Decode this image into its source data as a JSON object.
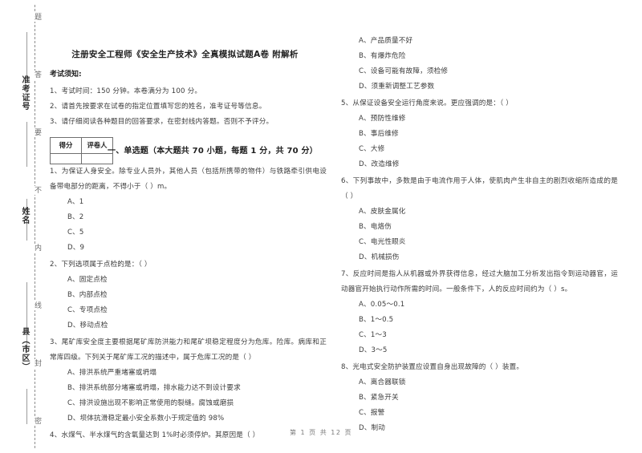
{
  "document": {
    "title": "注册安全工程师《安全生产技术》全真模拟试题A卷 附解析",
    "footer": "第 1 页 共 12 页"
  },
  "margin": {
    "labels": [
      "准考证号",
      "姓名",
      "县（市区）"
    ],
    "seal_chars": [
      "题",
      "答",
      "要",
      "不",
      "内",
      "线",
      "封",
      "密"
    ]
  },
  "notice": {
    "heading": "考试须知:",
    "items": [
      "1、考试时间：150 分钟。本卷满分为 100 分。",
      "2、请首先按要求在试卷的指定位置填写您的姓名，准考证号等信息。",
      "3、请仔细阅读各种题目的回答要求，在密封线内答题。否则不予评分。"
    ]
  },
  "score_box": {
    "col1": "得分",
    "col2": "评卷人",
    "value1": "",
    "value2": ""
  },
  "section": {
    "heading": "一、单选题（本大题共 70 小题，每题 1 分，共 70 分）"
  },
  "questions": {
    "q1": {
      "stem": "1、为保证人身安全。除专业人员外，其他人员（包括所携带的物件）与铁路牵引供电设备带电部分的距离，不得小于（     ）m。",
      "options": [
        "A、1",
        "B、2",
        "C、5",
        "D、9"
      ]
    },
    "q2": {
      "stem": "2、下列选项属于点检的是：（     ）",
      "options": [
        "A、固定点检",
        "B、内部点检",
        "C、专项点检",
        "D、移动点检"
      ]
    },
    "q3": {
      "stem": "3、尾矿库安全度主要根据尾矿库防洪能力和尾矿坝稳定程度分为危库。险库。病库和正常库四级。下列关于尾矿库工况的描述中，属于危库工况的是（     ）",
      "options": [
        "A、排洪系统严重堵塞或坍塌",
        "B、排洪系统部分堵塞或坍塌，排水能力达不到设计要求",
        "C、排洪设施出现不影响正常使用的裂缝。腐蚀或磨损",
        "D、坝体抗滑稳定最小安全系数小于规定值的 98%"
      ]
    },
    "q4": {
      "stem": "4、水煤气、半水煤气的含氧量达到 1%时必须停炉。其原因是（     ）",
      "options": []
    },
    "q4_cont": {
      "options": [
        "A、产品质量不好",
        "B、有爆炸危险",
        "C、设备可能有故障，须检修",
        "D、须重新调整工艺参数"
      ]
    },
    "q5": {
      "stem": "5、从保证设备安全运行角度来说。更应强调的是：（     ）",
      "options": [
        "A、预防性维修",
        "B、事后维修",
        "C、大修",
        "D、改造维修"
      ]
    },
    "q6": {
      "stem": "6、下列事故中，多数是由于电流作用于人体，使肌肉产生非自主的剧烈收缩所造成的是（     ）",
      "options": [
        "A、皮肤金属化",
        "B、电烙伤",
        "C、电光性眼炎",
        "D、机械损伤"
      ]
    },
    "q7": {
      "stem": "7、反应时间是指人从机器或外界获得信息，经过大脑加工分析发出指令到运动器官，运动器官开始执行动作所需的时间。一般条件下，人的反应时间约为（     ）s。",
      "options": [
        "A、0.05～0.1",
        "B、1～0.5",
        "C、1～3",
        "D、3～5"
      ]
    },
    "q8": {
      "stem": "8、光电式安全防护装置应设置自身出现故障的（     ）装置。",
      "options": [
        "A、离合器联锁",
        "B、紧急开关",
        "C、报警",
        "D、制动"
      ]
    }
  }
}
